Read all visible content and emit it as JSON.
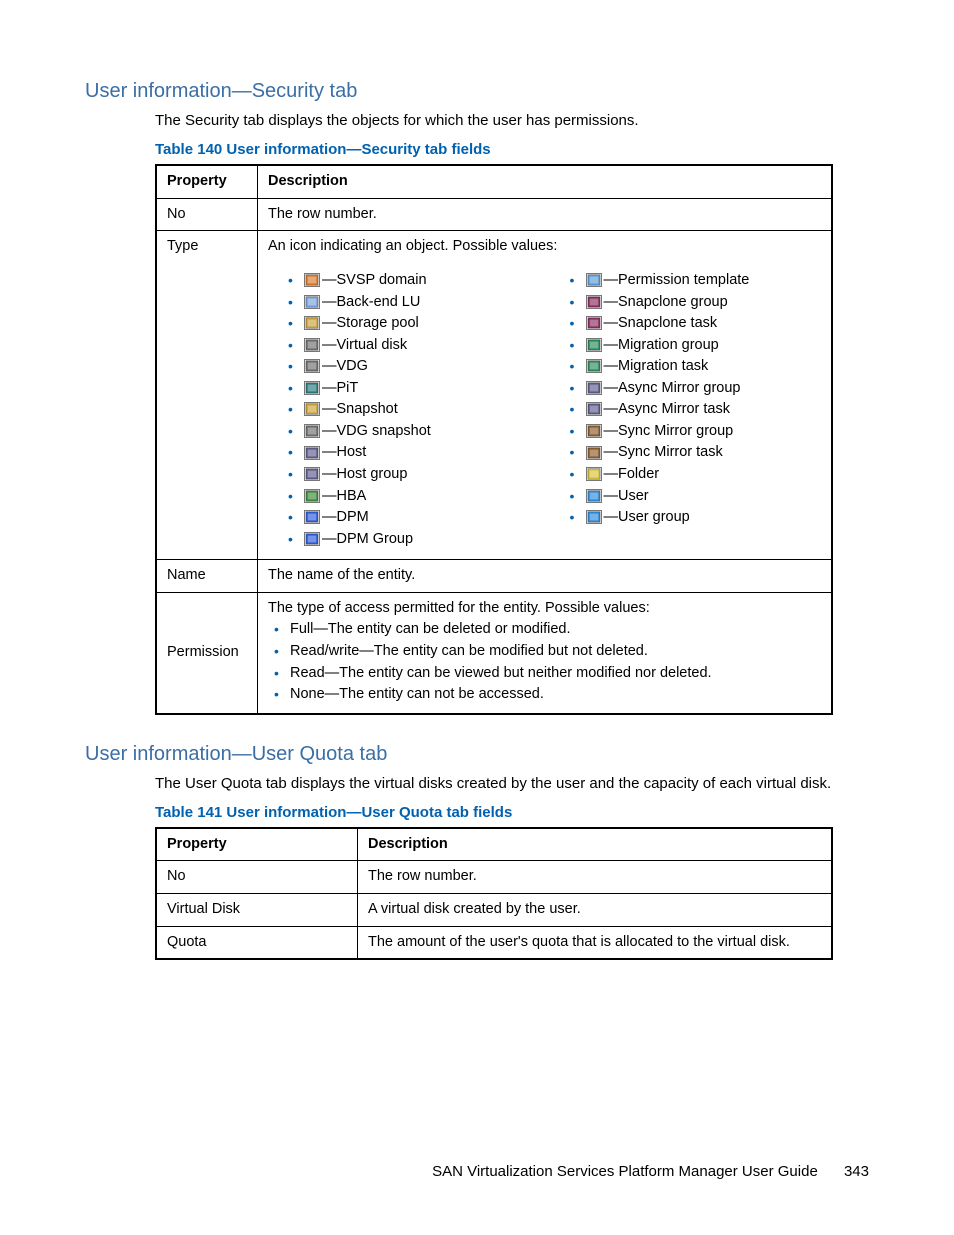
{
  "section1": {
    "heading": "User information—Security tab",
    "intro": "The Security tab displays the objects for which the user has permissions.",
    "caption": "Table 140 User information—Security tab fields",
    "headers": {
      "property": "Property",
      "description": "Description"
    },
    "rows": {
      "no": {
        "prop": "No",
        "desc": "The row number."
      },
      "type": {
        "prop": "Type",
        "lead": "An icon indicating an object. Possible values:",
        "left": [
          {
            "icon": "domain-icon",
            "label": "—SVSP domain"
          },
          {
            "icon": "backend-lu-icon",
            "label": "—Back-end LU"
          },
          {
            "icon": "storage-pool-icon",
            "label": "—Storage pool"
          },
          {
            "icon": "virtual-disk-icon",
            "label": "—Virtual disk"
          },
          {
            "icon": "vdg-icon",
            "label": "—VDG"
          },
          {
            "icon": "pit-icon",
            "label": "—PiT"
          },
          {
            "icon": "snapshot-icon",
            "label": "—Snapshot"
          },
          {
            "icon": "vdg-snapshot-icon",
            "label": "—VDG snapshot"
          },
          {
            "icon": "host-icon",
            "label": "—Host"
          },
          {
            "icon": "host-group-icon",
            "label": "—Host group"
          },
          {
            "icon": "hba-icon",
            "label": "—HBA"
          },
          {
            "icon": "dpm-icon",
            "label": "—DPM"
          },
          {
            "icon": "dpm-group-icon",
            "label": "—DPM Group"
          }
        ],
        "right": [
          {
            "icon": "permission-template-icon",
            "label": "—Permission template"
          },
          {
            "icon": "snapclone-group-icon",
            "label": "—Snapclone group"
          },
          {
            "icon": "snapclone-task-icon",
            "label": "—Snapclone task"
          },
          {
            "icon": "migration-group-icon",
            "label": "—Migration group"
          },
          {
            "icon": "migration-task-icon",
            "label": "—Migration task"
          },
          {
            "icon": "async-mirror-group-icon",
            "label": "—Async Mirror group"
          },
          {
            "icon": "async-mirror-task-icon",
            "label": "—Async Mirror task"
          },
          {
            "icon": "sync-mirror-group-icon",
            "label": "—Sync Mirror group"
          },
          {
            "icon": "sync-mirror-task-icon",
            "label": "—Sync Mirror task"
          },
          {
            "icon": "folder-icon",
            "label": "—Folder"
          },
          {
            "icon": "user-icon",
            "label": "—User"
          },
          {
            "icon": "user-group-icon",
            "label": "—User group"
          }
        ]
      },
      "name": {
        "prop": "Name",
        "desc": "The name of the entity."
      },
      "perm": {
        "prop": "Permission",
        "lead": "The type of access permitted for the entity. Possible values:",
        "items": [
          "Full—The entity can be deleted or modified.",
          "Read/write—The entity can be modified but not deleted.",
          "Read—The entity can be viewed but neither modified nor deleted.",
          "None—The entity can not be accessed."
        ]
      }
    }
  },
  "section2": {
    "heading": "User information—User Quota tab",
    "intro": "The User Quota tab displays the virtual disks created by the user and the capacity of each virtual disk.",
    "caption": "Table 141 User information—User Quota tab fields",
    "headers": {
      "property": "Property",
      "description": "Description"
    },
    "rows": [
      {
        "prop": "No",
        "desc": "The row number."
      },
      {
        "prop": "Virtual Disk",
        "desc": "A virtual disk created by the user."
      },
      {
        "prop": "Quota",
        "desc": "The amount of the user's quota that is allocated to the virtual disk."
      }
    ]
  },
  "footer": {
    "title": "SAN Virtualization Services Platform Manager User Guide",
    "page": "343"
  }
}
